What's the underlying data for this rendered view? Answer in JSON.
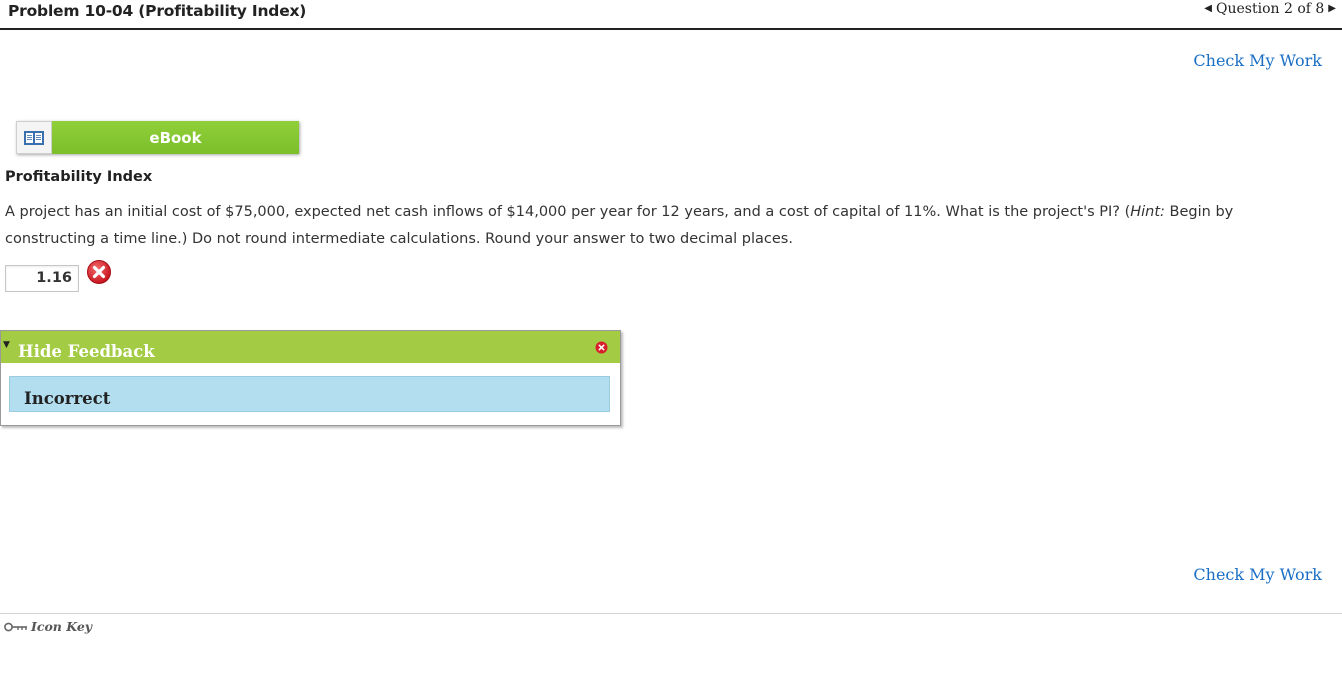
{
  "header": {
    "title": "Problem 10-04 (Profitability Index)",
    "question_nav": "Question 2 of 8"
  },
  "actions": {
    "check_my_work": "Check My Work"
  },
  "ebook": {
    "label": "eBook"
  },
  "problem": {
    "section_title": "Profitability Index",
    "text_before_hint": "A project has an initial cost of $75,000, expected net cash inflows of $14,000 per year for 12 years, and a cost of capital of 11%. What is the project's PI? (",
    "hint_label": "Hint:",
    "text_after_hint": " Begin by constructing a time line.) Do not round intermediate calculations. Round your answer to two decimal places.",
    "answer_value": "1.16",
    "answer_status": "incorrect"
  },
  "feedback": {
    "toggle_label": "Hide Feedback",
    "result": "Incorrect"
  },
  "footer": {
    "icon_key_label": "Icon Key"
  },
  "colors": {
    "accent_green": "#8fcf3a",
    "feedback_green": "#a3cc44",
    "feedback_body": "#b3def0",
    "link_blue": "#1a6fc4",
    "error_red": "#d8202b"
  },
  "icons": {
    "ebook": "open-book-icon",
    "wrong": "x-circle-icon",
    "close": "close-icon",
    "key": "key-icon",
    "prev": "triangle-left-icon",
    "next": "triangle-right-icon"
  }
}
